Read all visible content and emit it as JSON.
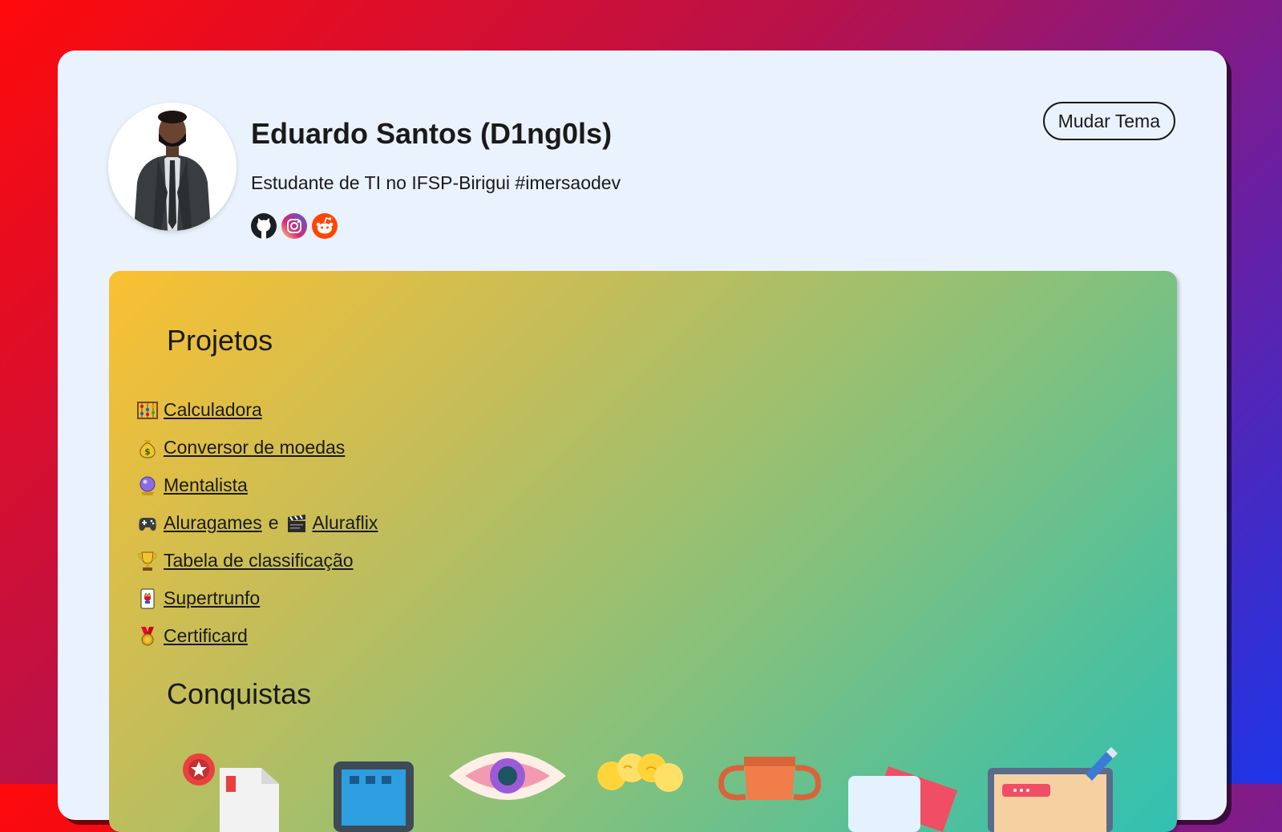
{
  "profile": {
    "name": "Eduardo Santos (D1ng0ls)",
    "bio": "Estudante de TI no IFSP-Birigui #imersaodev",
    "socials": [
      {
        "icon": "github-icon"
      },
      {
        "icon": "instagram-icon"
      },
      {
        "icon": "reddit-icon"
      }
    ]
  },
  "theme_button": "Mudar Tema",
  "projects": {
    "title": "Projetos",
    "items": [
      {
        "icon": "abacus-icon",
        "label": "Calculadora"
      },
      {
        "icon": "money-bag-icon",
        "label": "Conversor de moedas"
      },
      {
        "icon": "crystal-ball-icon",
        "label": "Mentalista"
      },
      {
        "icon": "gamepad-icon",
        "label": "Aluragames",
        "connector": "e",
        "icon2": "clapper-icon",
        "label2": "Aluraflix"
      },
      {
        "icon": "trophy-icon",
        "label": "Tabela de classificação"
      },
      {
        "icon": "joker-card-icon",
        "label": "Supertrunfo"
      },
      {
        "icon": "medal-icon",
        "label": "Certificard"
      }
    ]
  },
  "achievements": {
    "title": "Conquistas",
    "badges": [
      {
        "icon": "certificate-badge-icon"
      },
      {
        "icon": "calendar-badge-icon"
      },
      {
        "icon": "eye-badge-icon"
      },
      {
        "icon": "popcorn-badge-icon"
      },
      {
        "icon": "trophy-badge-icon"
      },
      {
        "icon": "cards-badge-icon"
      },
      {
        "icon": "design-badge-icon"
      }
    ]
  },
  "colors": {
    "page_gradient": [
      "#ff0a0a",
      "#1e35e8"
    ],
    "card_background": "#eaf2fd",
    "panel_gradient": [
      "#fac031",
      "#30c1b2"
    ]
  }
}
